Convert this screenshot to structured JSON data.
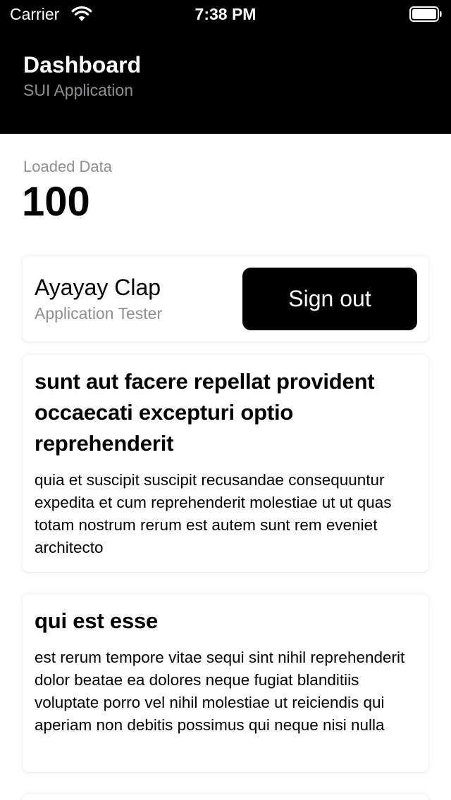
{
  "status_bar": {
    "carrier": "Carrier",
    "time": "7:38 PM",
    "wifi_icon": "wifi-icon",
    "battery_icon": "battery-icon"
  },
  "header": {
    "title": "Dashboard",
    "subtitle": "SUI Application",
    "background": "#000000"
  },
  "loaded": {
    "label": "Loaded Data",
    "value": "100"
  },
  "user": {
    "name": "Ayayay Clap",
    "role": "Application Tester",
    "sign_out_label": "Sign out"
  },
  "posts": [
    {
      "title": "sunt aut facere repellat provident occaecati excepturi optio reprehenderit",
      "body": "quia et suscipit suscipit recusandae consequuntur expedita et cum reprehenderit molestiae ut ut quas totam nostrum rerum est autem sunt rem eveniet architecto"
    },
    {
      "title": "qui est esse",
      "body": "est rerum tempore vitae sequi sint nihil reprehenderit dolor beatae ea dolores neque fugiat blanditiis voluptate porro vel nihil molestiae ut reiciendis qui aperiam non debitis possimus qui neque nisi nulla"
    }
  ],
  "colors": {
    "secondary_text": "#8e8e93",
    "button_background": "#000000",
    "button_text": "#ffffff"
  }
}
